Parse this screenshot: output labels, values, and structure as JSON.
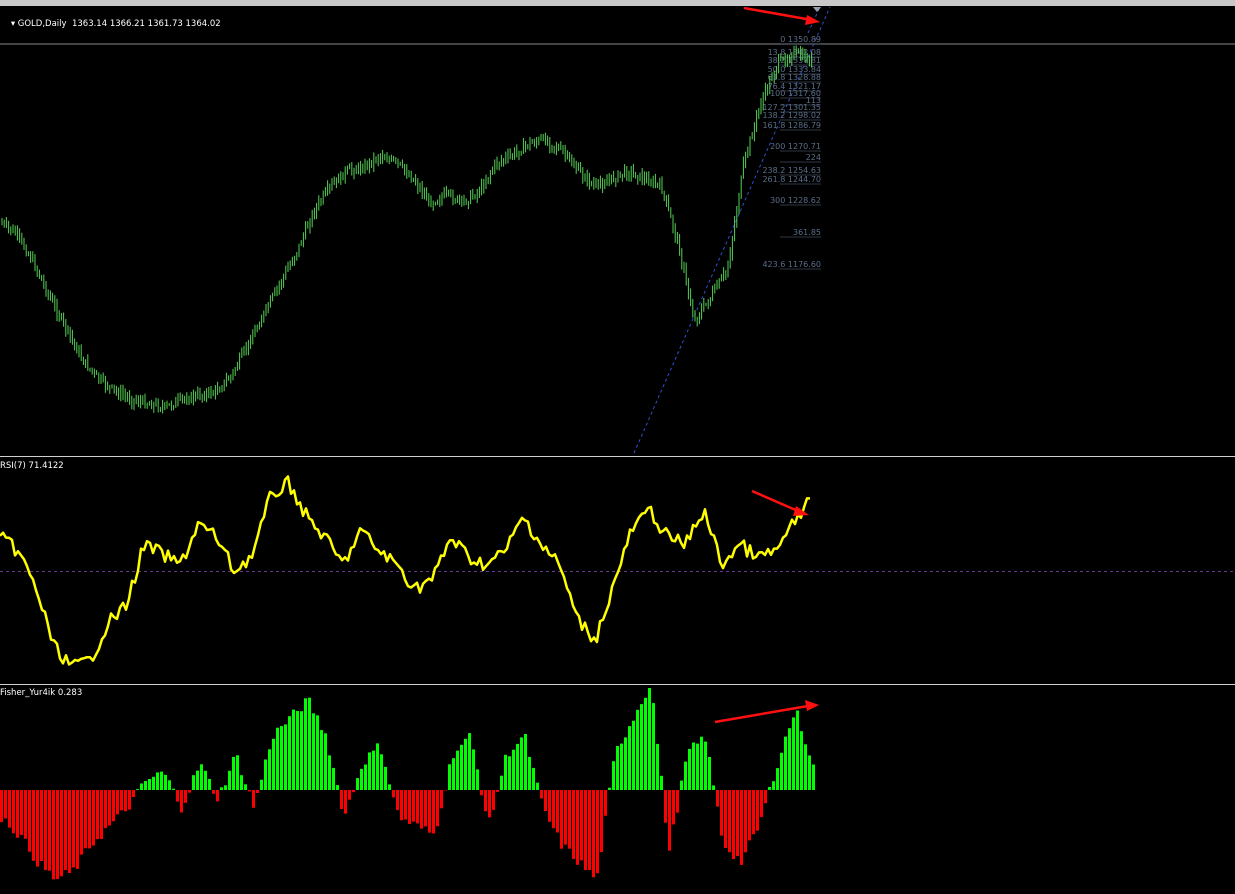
{
  "main": {
    "symbol": "GOLD,Daily",
    "ohlc": "1363.14 1366.21 1361.73 1364.02",
    "fib_levels": [
      {
        "level": "0",
        "price": "1350.89"
      },
      {
        "level": "13.8",
        "price": "1342.08"
      },
      {
        "level": "38.2",
        "price": "1337.81"
      },
      {
        "level": "50.0",
        "price": "1333.84"
      },
      {
        "level": "61.8",
        "price": "1328.88"
      },
      {
        "level": "76.4",
        "price": "1321.17"
      },
      {
        "level": "100",
        "price": "1317.60"
      },
      {
        "level": "113",
        "price": ""
      },
      {
        "level": "127.2",
        "price": "1301.35"
      },
      {
        "level": "138.2",
        "price": "1298.02"
      },
      {
        "level": "161.8",
        "price": "1286.79"
      },
      {
        "level": "200",
        "price": "1270.71"
      },
      {
        "level": "224",
        "price": ""
      },
      {
        "level": "238.2",
        "price": "1254.63"
      },
      {
        "level": "261.8",
        "price": "1244.70"
      },
      {
        "level": "300",
        "price": "1228.62"
      },
      {
        "level": "361.85",
        "price": ""
      },
      {
        "level": "423.6",
        "price": "1176.60"
      }
    ]
  },
  "rsi": {
    "label": "RSI(7) 71.4122",
    "level": 50
  },
  "fisher": {
    "label": "Fisher_Yur4ik 0.283"
  },
  "colors": {
    "candle": "#55d155",
    "rsi": "#ffff00",
    "fisher_up": "#00ff00",
    "fisher_down": "#ff0000",
    "arrow": "#ff1010",
    "fib": "#5a6e87"
  },
  "chart_data": [
    {
      "type": "line",
      "title": "GOLD,Daily",
      "series": [
        {
          "name": "GOLD,Daily",
          "values": [
            1315,
            1312,
            1305,
            1296,
            1288,
            1280,
            1275,
            1272,
            1270,
            1269,
            1268,
            1270,
            1271,
            1272,
            1276,
            1284,
            1292,
            1300,
            1308,
            1318,
            1324,
            1328,
            1329,
            1332,
            1330,
            1326,
            1320,
            1322,
            1320,
            1323,
            1330,
            1332,
            1335,
            1336,
            1333,
            1328,
            1324,
            1326,
            1328,
            1326,
            1324,
            1310,
            1290,
            1296,
            1303,
            1330,
            1345,
            1355,
            1358,
            1356
          ]
        }
      ]
    },
    {
      "type": "line",
      "title": "RSI(7) 71.4122",
      "series": [
        {
          "name": "RSI(7)",
          "values": [
            60,
            56,
            45,
            28,
            22,
            24,
            35,
            40,
            58,
            55,
            52,
            64,
            60,
            50,
            55,
            72,
            76,
            66,
            60,
            52,
            62,
            56,
            52,
            45,
            48,
            60,
            54,
            52,
            56,
            66,
            58,
            52,
            36,
            30,
            46,
            62,
            68,
            60,
            58,
            68,
            52,
            58,
            54,
            56,
            64,
            71.4
          ]
        }
      ]
    },
    {
      "type": "bar",
      "title": "Fisher_Yur4ik 0.283",
      "series": [
        {
          "name": "Fisher_Yur4ik",
          "values": [
            -0.3,
            -0.5,
            -0.8,
            -1.0,
            -0.9,
            -0.6,
            -0.4,
            -0.2,
            0.1,
            0.2,
            -0.2,
            0.3,
            -0.1,
            0.4,
            -0.2,
            0.6,
            0.8,
            1.0,
            0.6,
            -0.3,
            0.3,
            0.5,
            -0.3,
            -0.4,
            -0.5,
            0.4,
            0.6,
            -0.4,
            0.4,
            0.6,
            -0.2,
            -0.6,
            -0.8,
            -1.0,
            0.4,
            0.8,
            1.2,
            -0.7,
            0.4,
            0.6,
            -0.6,
            -0.8,
            -0.4,
            0.3,
            0.9,
            0.283
          ]
        }
      ]
    }
  ]
}
